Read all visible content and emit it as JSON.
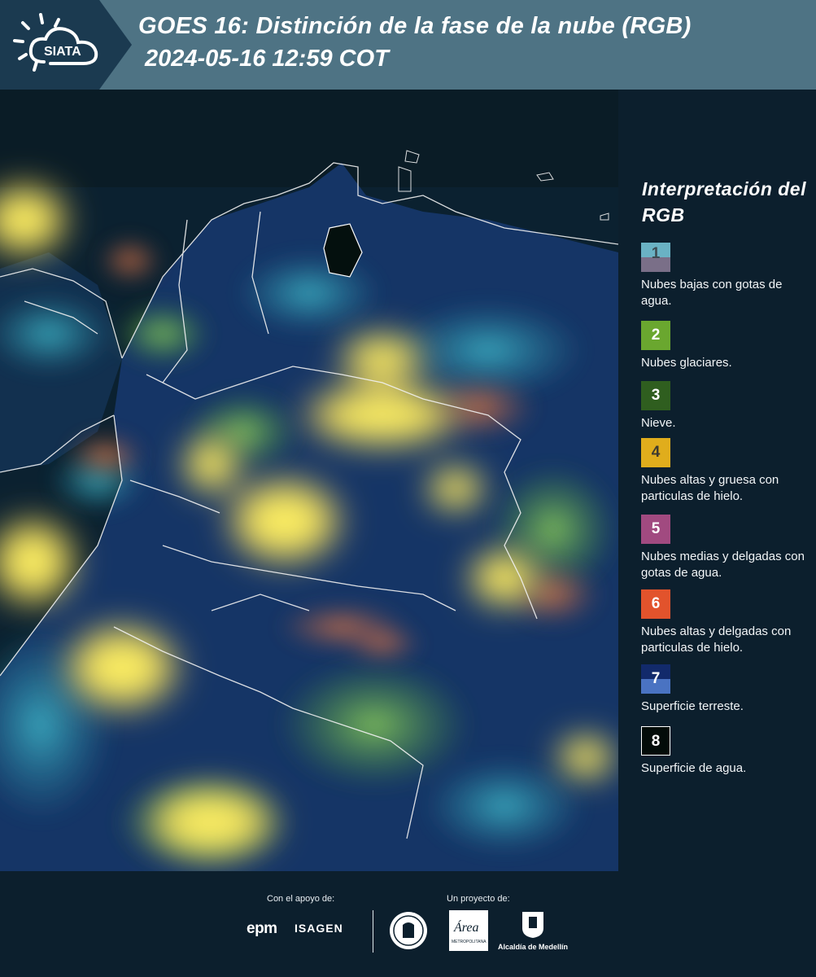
{
  "header": {
    "logo_text": "SIATA",
    "title_line1": "GOES 16: Distinción de la fase de la nube (RGB)",
    "title_line2": "2024-05-16 12:59 COT"
  },
  "legend": {
    "title": "Interpretación del RGB",
    "items": [
      {
        "number": "1",
        "label": "Nubes bajas con gotas de agua.",
        "color_top": "#6ab2c4",
        "color_bottom": "#7a6f88"
      },
      {
        "number": "2",
        "label": "Nubes glaciares.",
        "color": "#6aa72f"
      },
      {
        "number": "3",
        "label": "Nieve.",
        "color": "#2f5e1f"
      },
      {
        "number": "4",
        "label": "Nubes altas y gruesa con particulas de hielo.",
        "color": "#e0ad1c"
      },
      {
        "number": "5",
        "label": "Nubes medias y delgadas con gotas de agua.",
        "color": "#a14a80"
      },
      {
        "number": "6",
        "label": "Nubes altas y delgadas con particulas de hielo.",
        "color": "#e2532c"
      },
      {
        "number": "7",
        "label": "Superficie terreste.",
        "color_top": "#122a6b",
        "color_bottom": "#4a73c2"
      },
      {
        "number": "8",
        "label": "Superficie de agua.",
        "color": "#030c09"
      }
    ]
  },
  "footer": {
    "support_label": "Con el apoyo de:",
    "project_label": "Un proyecto de:",
    "sponsor1": "epm",
    "sponsor2": "ISAGEN",
    "area_name": "Área",
    "area_sub": "METROPOLITANA",
    "alcaldia": "Alcaldía de Medellín"
  }
}
